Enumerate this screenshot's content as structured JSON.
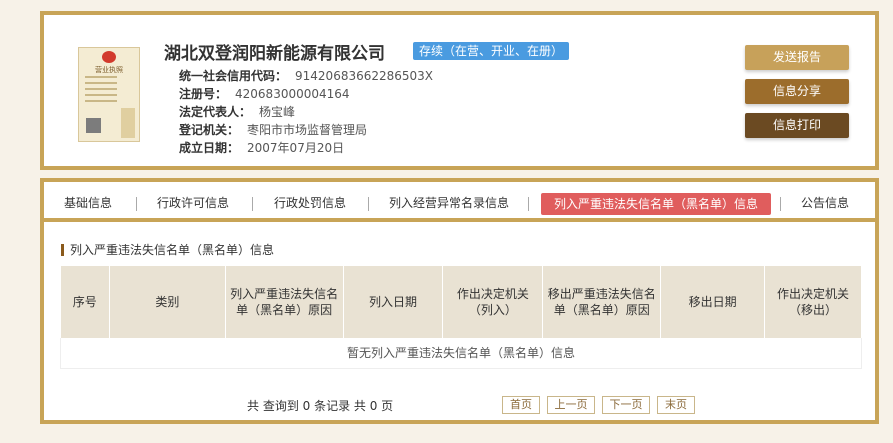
{
  "company": {
    "name": "湖北双登润阳新能源有限公司",
    "status": "存续（在营、开业、在册）",
    "license_image_label": "营业执照",
    "fields": [
      {
        "label": "统一社会信用代码：",
        "value": "91420683662286503X"
      },
      {
        "label": "注册号：",
        "value": "420683000004164"
      },
      {
        "label": "法定代表人：",
        "value": "杨宝峰"
      },
      {
        "label": "登记机关：",
        "value": "枣阳市市场监督管理局"
      },
      {
        "label": "成立日期：",
        "value": "2007年07月20日"
      }
    ]
  },
  "actions": {
    "report": "发送报告",
    "share": "信息分享",
    "print": "信息打印"
  },
  "colors": {
    "accent": "#c8a457",
    "active_tab": "#e05d5d",
    "status_badge": "#4a9be0"
  },
  "tabs": [
    {
      "label": "基础信息"
    },
    {
      "label": "行政许可信息"
    },
    {
      "label": "行政处罚信息"
    },
    {
      "label": "列入经营异常名录信息"
    },
    {
      "label": "列入严重违法失信名单（黑名单）信息",
      "active": true
    },
    {
      "label": "公告信息"
    }
  ],
  "section": {
    "title": "列入严重违法失信名单（黑名单）信息",
    "columns": [
      "序号",
      "类别",
      "列入严重违法失信名单（黑名单）原因",
      "列入日期",
      "作出决定机关（列入）",
      "移出严重违法失信名单（黑名单）原因",
      "移出日期",
      "作出决定机关（移出）"
    ],
    "empty_message": "暂无列入严重违法失信名单（黑名单）信息"
  },
  "pager": {
    "summary": "共 查询到 0 条记录 共 0 页",
    "first": "首页",
    "prev": "上一页",
    "next": "下一页",
    "last": "末页"
  }
}
